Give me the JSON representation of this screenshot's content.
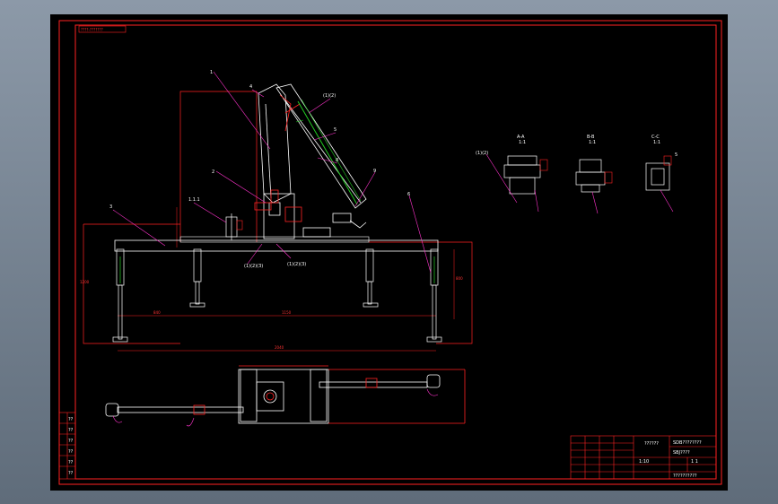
{
  "drawing": {
    "tag": "????-???????",
    "views": [
      {
        "label": "A-A",
        "scale": "1:1"
      },
      {
        "label": "B-B",
        "scale": "1:1"
      },
      {
        "label": "C-C",
        "scale": "1:1"
      }
    ],
    "callouts": {
      "c1": "1",
      "c2": "2",
      "c3": "3",
      "c4": "4",
      "c5": "5",
      "c6": "6",
      "c7": "7",
      "c8": "(1)(2)",
      "c9": "(1)(2)",
      "c10": "(1)(2)(3)",
      "c11": "(1)(2)(3)",
      "c12": "1.1.1",
      "c13": "5",
      "c14": "8",
      "c15": "9"
    },
    "dims": {
      "overall_width": "2040",
      "span_mid": "1150",
      "span_left": "840",
      "height_right": "800",
      "height_left": "1200"
    }
  },
  "title_block": {
    "drawing_no": "SDB????????",
    "part_name": "SBJ????",
    "product": "??????",
    "company": "??????????",
    "scale": "1:10",
    "sheet": "1  1"
  },
  "side_labels": [
    "??",
    "??",
    "??",
    "??",
    "??",
    "??"
  ]
}
